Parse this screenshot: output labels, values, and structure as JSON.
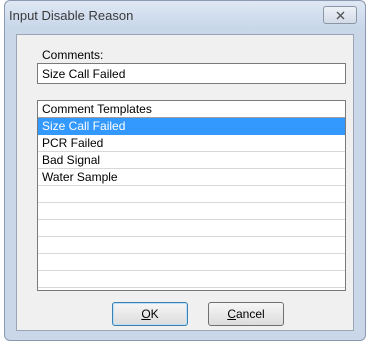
{
  "window": {
    "title": "Input Disable Reason"
  },
  "comments": {
    "label": "Comments:",
    "value": "Size Call Failed"
  },
  "templates": {
    "header": "Comment Templates",
    "items": [
      "Size Call Failed",
      "PCR Failed",
      "Bad Signal",
      "Water Sample"
    ],
    "selected_index": 0
  },
  "buttons": {
    "ok": {
      "underlined": "O",
      "rest": "K"
    },
    "cancel": {
      "underlined": "C",
      "rest": "ancel"
    }
  },
  "colors": {
    "selection": "#3399ff"
  }
}
